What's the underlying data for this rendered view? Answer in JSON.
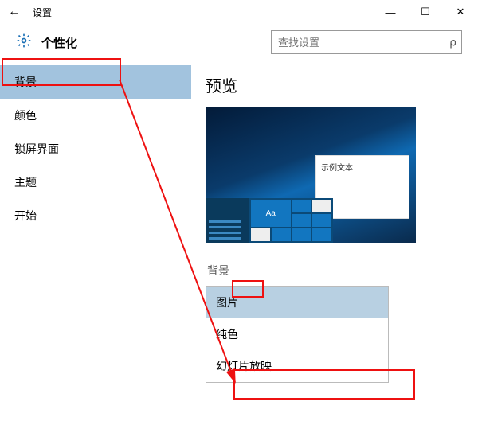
{
  "window": {
    "title": "设置",
    "back_glyph": "←",
    "min_glyph": "—",
    "max_glyph": "☐",
    "close_glyph": "✕"
  },
  "header": {
    "title": "个性化",
    "search_placeholder": "查找设置",
    "search_value": ""
  },
  "sidebar": {
    "items": [
      {
        "label": "背景",
        "active": true
      },
      {
        "label": "颜色",
        "active": false
      },
      {
        "label": "锁屏界面",
        "active": false
      },
      {
        "label": "主题",
        "active": false
      },
      {
        "label": "开始",
        "active": false
      }
    ]
  },
  "content": {
    "preview_heading": "预览",
    "sample_text": "示例文本",
    "tile_aa": "Aa",
    "dropdown_label": "背景",
    "dropdown_options": [
      {
        "label": "图片",
        "state": "hover"
      },
      {
        "label": "纯色",
        "state": ""
      },
      {
        "label": "幻灯片放映",
        "state": "selected"
      }
    ]
  }
}
